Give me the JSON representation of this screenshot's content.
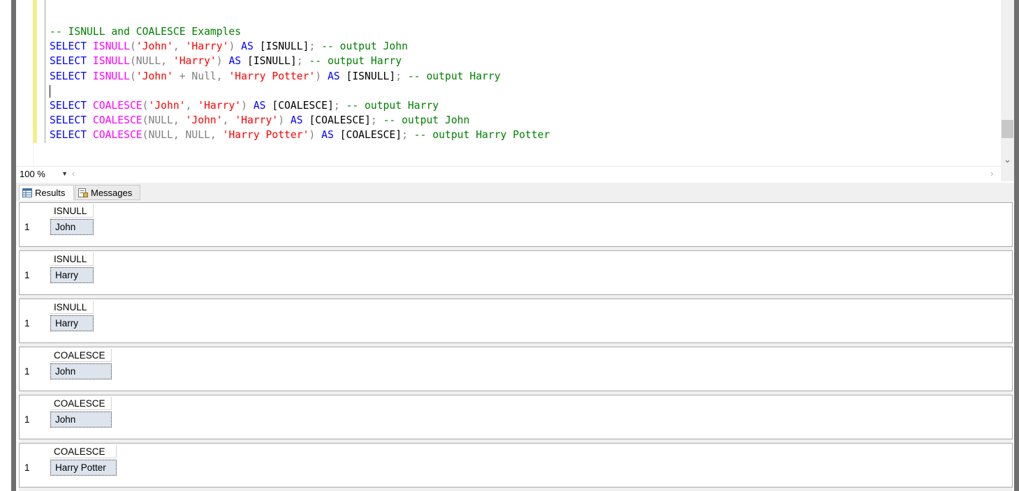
{
  "editor": {
    "lines": [
      {
        "tokens": [
          {
            "t": "-- ISNULL and COALESCE Examples",
            "c": "cm"
          }
        ]
      },
      {
        "tokens": [
          {
            "t": "SELECT ",
            "c": "kw"
          },
          {
            "t": "ISNULL",
            "c": "fn"
          },
          {
            "t": "(",
            "c": "gray"
          },
          {
            "t": "'John'",
            "c": "str"
          },
          {
            "t": ", ",
            "c": "gray"
          },
          {
            "t": "'Harry'",
            "c": "str"
          },
          {
            "t": ") ",
            "c": "gray"
          },
          {
            "t": "AS ",
            "c": "kw"
          },
          {
            "t": "[ISNULL]",
            "c": ""
          },
          {
            "t": "; ",
            "c": "gray"
          },
          {
            "t": "-- output John",
            "c": "cm"
          }
        ]
      },
      {
        "tokens": [
          {
            "t": "SELECT ",
            "c": "kw"
          },
          {
            "t": "ISNULL",
            "c": "fn"
          },
          {
            "t": "(NULL, ",
            "c": "gray"
          },
          {
            "t": "'Harry'",
            "c": "str"
          },
          {
            "t": ") ",
            "c": "gray"
          },
          {
            "t": "AS ",
            "c": "kw"
          },
          {
            "t": "[ISNULL]",
            "c": ""
          },
          {
            "t": "; ",
            "c": "gray"
          },
          {
            "t": "-- output Harry",
            "c": "cm"
          }
        ]
      },
      {
        "tokens": [
          {
            "t": "SELECT ",
            "c": "kw"
          },
          {
            "t": "ISNULL",
            "c": "fn"
          },
          {
            "t": "(",
            "c": "gray"
          },
          {
            "t": "'John'",
            "c": "str"
          },
          {
            "t": " + Null, ",
            "c": "gray"
          },
          {
            "t": "'Harry Potter'",
            "c": "str"
          },
          {
            "t": ") ",
            "c": "gray"
          },
          {
            "t": "AS ",
            "c": "kw"
          },
          {
            "t": "[ISNULL]",
            "c": ""
          },
          {
            "t": "; ",
            "c": "gray"
          },
          {
            "t": "-- output Harry",
            "c": "cm"
          }
        ]
      },
      {
        "tokens": [],
        "caret": true
      },
      {
        "tokens": [
          {
            "t": "SELECT ",
            "c": "kw"
          },
          {
            "t": "COALESCE",
            "c": "fn"
          },
          {
            "t": "(",
            "c": "gray"
          },
          {
            "t": "'John'",
            "c": "str"
          },
          {
            "t": ", ",
            "c": "gray"
          },
          {
            "t": "'Harry'",
            "c": "str"
          },
          {
            "t": ") ",
            "c": "gray"
          },
          {
            "t": "AS ",
            "c": "kw"
          },
          {
            "t": "[COALESCE]",
            "c": ""
          },
          {
            "t": "; ",
            "c": "gray"
          },
          {
            "t": "-- output Harry",
            "c": "cm"
          }
        ]
      },
      {
        "tokens": [
          {
            "t": "SELECT ",
            "c": "kw"
          },
          {
            "t": "COALESCE",
            "c": "fn"
          },
          {
            "t": "(NULL, ",
            "c": "gray"
          },
          {
            "t": "'John'",
            "c": "str"
          },
          {
            "t": ", ",
            "c": "gray"
          },
          {
            "t": "'Harry'",
            "c": "str"
          },
          {
            "t": ") ",
            "c": "gray"
          },
          {
            "t": "AS ",
            "c": "kw"
          },
          {
            "t": "[COALESCE]",
            "c": ""
          },
          {
            "t": "; ",
            "c": "gray"
          },
          {
            "t": "-- output John",
            "c": "cm"
          }
        ]
      },
      {
        "tokens": [
          {
            "t": "SELECT ",
            "c": "kw"
          },
          {
            "t": "COALESCE",
            "c": "fn"
          },
          {
            "t": "(NULL, NULL, ",
            "c": "gray"
          },
          {
            "t": "'Harry Potter'",
            "c": "str"
          },
          {
            "t": ") ",
            "c": "gray"
          },
          {
            "t": "AS ",
            "c": "kw"
          },
          {
            "t": "[COALESCE]",
            "c": ""
          },
          {
            "t": "; ",
            "c": "gray"
          },
          {
            "t": "-- output Harry Potter",
            "c": "cm"
          }
        ]
      }
    ]
  },
  "zoom": {
    "value": "100 %"
  },
  "tabs": {
    "results_label": "Results",
    "messages_label": "Messages"
  },
  "results": [
    {
      "header": "ISNULL",
      "row_number": "1",
      "value": "John"
    },
    {
      "header": "ISNULL",
      "row_number": "1",
      "value": "Harry"
    },
    {
      "header": "ISNULL",
      "row_number": "1",
      "value": "Harry"
    },
    {
      "header": "COALESCE",
      "row_number": "1",
      "value": "John"
    },
    {
      "header": "COALESCE",
      "row_number": "1",
      "value": "John"
    },
    {
      "header": "COALESCE",
      "row_number": "1",
      "value": "Harry Potter"
    }
  ],
  "colors": {
    "keyword": "#0000ff",
    "function": "#ff00ff",
    "string": "#ff0000",
    "comment": "#008000",
    "operator": "#808080",
    "change_bar": "#f4f08a"
  }
}
